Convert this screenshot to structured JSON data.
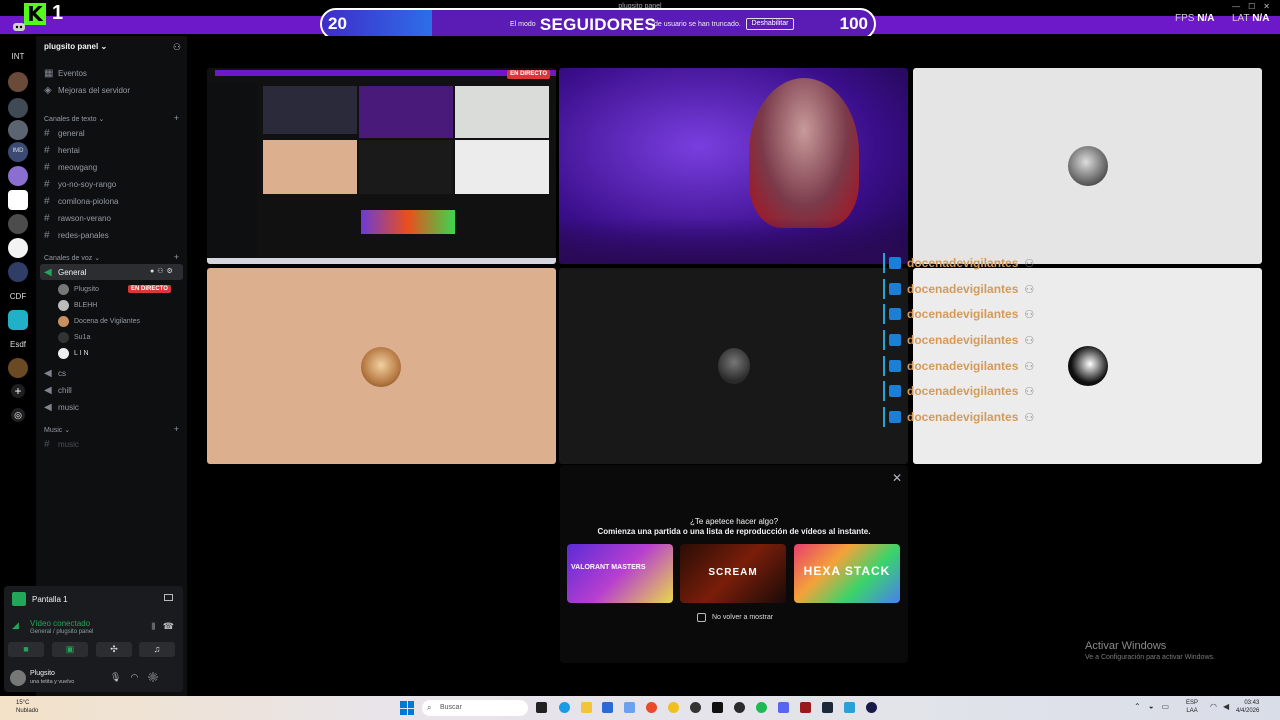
{
  "overlay": {
    "kick_logo": "K",
    "kick_count": "1",
    "window_title": "plugsito panel",
    "goal": {
      "title": "SEGUIDORES",
      "current": "20",
      "target": "100",
      "progress_fraction": 0.2
    },
    "truncation_notice_left": "El modo",
    "truncation_notice_right": "de usuario se han truncado.",
    "disable_button": "Deshabilitar",
    "fps_label": "FPS",
    "fps_value": "N/A",
    "lat_label": "LAT",
    "lat_value": "N/A"
  },
  "rail": {
    "labels": [
      "INT",
      "IMD",
      "CDF",
      "Esdf"
    ],
    "add_icon": "plus-icon",
    "discover_icon": "compass-icon"
  },
  "sidebar": {
    "server_name": "plugsito panel",
    "events": "Eventos",
    "boosts": "Mejoras del servidor",
    "text_category": "Canales de texto",
    "text_channels": [
      "general",
      "hentai",
      "meowgang",
      "yo-no-soy-rango",
      "comilona-piolona",
      "rawson-verano",
      "redes-panales"
    ],
    "voice_category": "Canales de voz",
    "voice_general": "General",
    "voice_users": [
      "Plugsito",
      "BLEHH",
      "Docena de Vigilantes",
      "Su1a",
      "L I N"
    ],
    "live_badge": "EN DIRECTO",
    "other_voice": [
      "cs",
      "chill",
      "music"
    ],
    "music_category": "Music",
    "music_channel": "music"
  },
  "user_panel": {
    "screen_label": "Pantalla 1",
    "connected_title": "Vídeo conectado",
    "connected_sub": "General / plugsito panel",
    "username": "Plugsito",
    "status": "una tetita y vuelvo"
  },
  "stream": {
    "mini_badge": "EN DIRECTO",
    "alerts": [
      "docenadevigilantes",
      "docenadevigilantes",
      "docenadevigilantes",
      "docenadevigilantes",
      "docenadevigilantes",
      "docenadevigilantes",
      "docenadevigilantes"
    ]
  },
  "popup": {
    "title": "¿Te apetece hacer algo?",
    "subtitle": "Comienza una partida o una lista de reproducción de vídeos al instante.",
    "games": [
      "VALORANT MASTERS",
      "SCREAM",
      "HEXA STACK"
    ],
    "dont_show": "No volver a mostrar"
  },
  "windows": {
    "activate": "Activar Windows",
    "activate_sub": "Ve a Configuración para activar Windows."
  },
  "taskbar": {
    "temp": "15°C",
    "weather": "Nublado",
    "search": "Buscar",
    "lang1": "ESP",
    "lang2": "LAA",
    "time": "03:43",
    "date": "4/4/2026"
  },
  "colors": {
    "brand_purple": "#6d18c9",
    "kick_green": "#53fc18",
    "discord_green": "#23a55a",
    "live_red": "#da373c",
    "alert_orange": "#d49a5a"
  }
}
